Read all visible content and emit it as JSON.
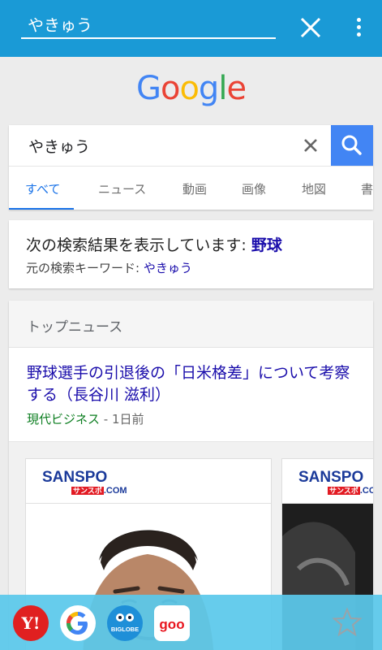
{
  "appbar": {
    "query": "やきゅう",
    "close_icon": "close-icon",
    "menu_icon": "more-vert-icon"
  },
  "logo": {
    "text": "Google",
    "letters": [
      {
        "ch": "G",
        "color": "#4285f4"
      },
      {
        "ch": "o",
        "color": "#ea4335"
      },
      {
        "ch": "o",
        "color": "#fbbc05"
      },
      {
        "ch": "g",
        "color": "#4285f4"
      },
      {
        "ch": "l",
        "color": "#34a853"
      },
      {
        "ch": "e",
        "color": "#ea4335"
      }
    ]
  },
  "search": {
    "value": "やきゅう",
    "clear_icon": "clear-icon",
    "search_icon": "search-icon",
    "tabs": [
      {
        "label": "すべて"
      },
      {
        "label": "ニュース"
      },
      {
        "label": "動画"
      },
      {
        "label": "画像"
      },
      {
        "label": "地図"
      },
      {
        "label": "書"
      }
    ]
  },
  "correction": {
    "showing_prefix": "次の検索結果を表示しています: ",
    "corrected_term": "野球",
    "original_prefix": "元の検索キーワード: ",
    "original_term": "やきゅう"
  },
  "top_news": {
    "header": "トップニュース",
    "article": {
      "title": "野球選手の引退後の「日米格差」について考察する（長谷川 滋利）",
      "source": "現代ビジネス",
      "age": " - 1日前"
    },
    "tiles": [
      {
        "brand": "SANSPO",
        "brand_sub_red": "サンスポ",
        "brand_sub": ".COM"
      },
      {
        "brand": "SANSPO",
        "brand_sub_red": "サンスポ",
        "brand_sub": ".COM"
      }
    ]
  },
  "dock": {
    "apps": [
      {
        "name": "Yahoo!",
        "icon": "yahoo-icon",
        "glyph": "Y!",
        "color": "#e02020"
      },
      {
        "name": "Google",
        "icon": "google-icon",
        "glyph": "G",
        "color": "#ffffff"
      },
      {
        "name": "BIGLOBE",
        "icon": "biglobe-icon",
        "glyph": "BIGLOBE",
        "color": "#1e8fd8"
      },
      {
        "name": "goo",
        "icon": "goo-icon",
        "glyph": "goo",
        "color": "#ffffff"
      }
    ],
    "favorite_icon": "star-outline-icon"
  }
}
